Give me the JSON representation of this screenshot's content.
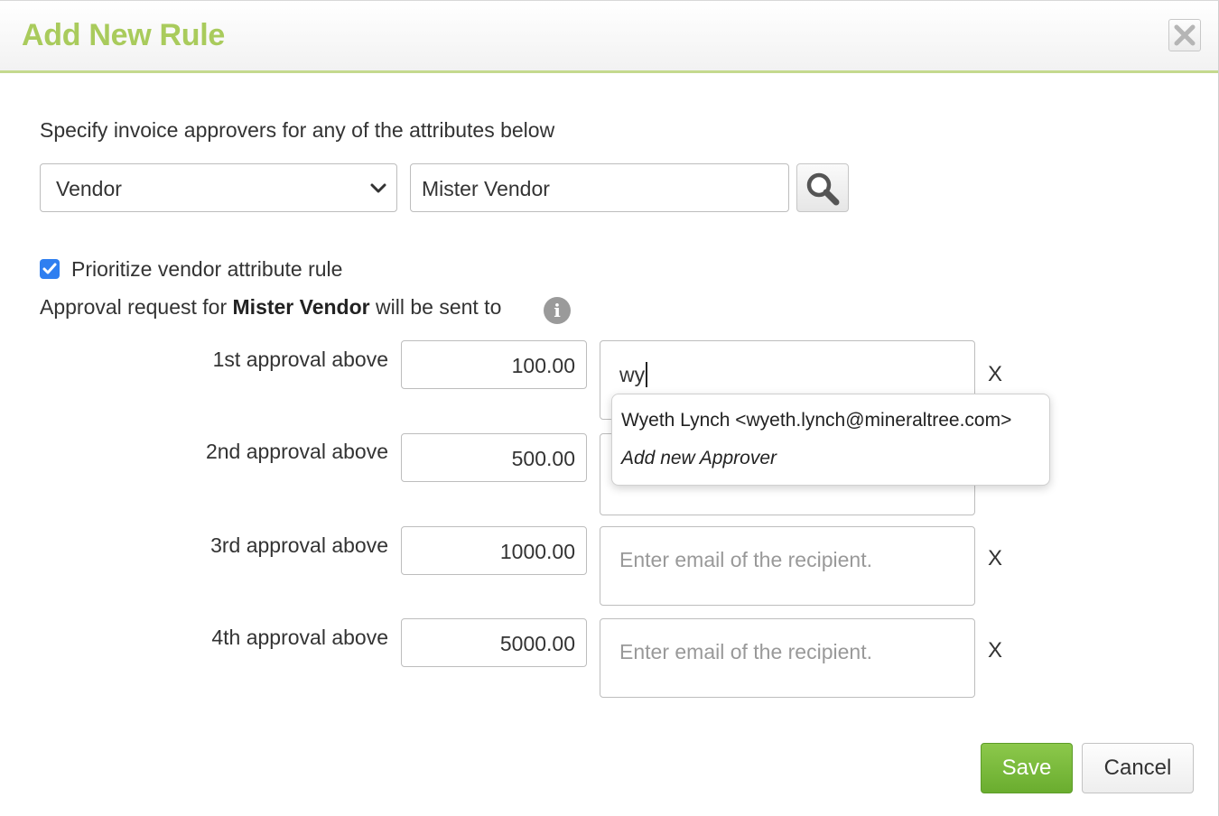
{
  "dialog": {
    "title": "Add New Rule",
    "close_icon": "close-icon"
  },
  "form": {
    "intro": "Specify invoice approvers for any of the attributes below",
    "attribute_select": {
      "value": "Vendor",
      "icon": "chevron-down-icon"
    },
    "attribute_value": "Mister Vendor",
    "search_icon": "search-icon",
    "prioritize": {
      "checked": true,
      "label": "Prioritize vendor attribute rule"
    },
    "approval_sentence": {
      "prefix": "Approval request for",
      "vendor": "Mister Vendor",
      "suffix": "will be sent to",
      "icon": "info-icon"
    }
  },
  "approvals": [
    {
      "label": "1st approval above",
      "amount": "100.00",
      "email_value": "wy",
      "email_placeholder": "",
      "remove": "X"
    },
    {
      "label": "2nd approval above",
      "amount": "500.00",
      "email_value": "",
      "email_placeholder": "",
      "remove": ""
    },
    {
      "label": "3rd approval above",
      "amount": "1000.00",
      "email_value": "",
      "email_placeholder": "Enter email of the recipient.",
      "remove": "X"
    },
    {
      "label": "4th approval above",
      "amount": "5000.00",
      "email_value": "",
      "email_placeholder": "Enter email of the recipient.",
      "remove": "X"
    }
  ],
  "autocomplete": {
    "items": [
      "Wyeth Lynch <wyeth.lynch@mineraltree.com>",
      "Add new Approver"
    ]
  },
  "footer": {
    "save_label": "Save",
    "cancel_label": "Cancel"
  },
  "colors": {
    "title": "#a9cb5c",
    "header_rule": "#c4d98e",
    "save_button": "#7aba3c",
    "checkbox": "#2f7ff0"
  }
}
